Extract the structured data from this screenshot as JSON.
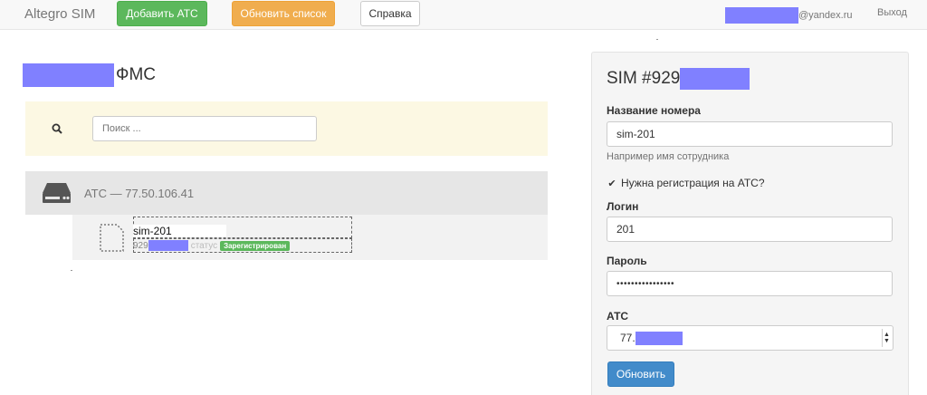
{
  "navbar": {
    "brand": "Altegro SIM",
    "add_pbx_label": "Добавить АТС",
    "refresh_list_label": "Обновить список",
    "help_label": "Справка",
    "user_email_suffix": "@yandex.ru",
    "logout_label": "Выход"
  },
  "main": {
    "title_suffix": "ФМС",
    "search": {
      "placeholder": "Поиск ..."
    },
    "pbx": {
      "title": "АТС — 77.50.106.41",
      "sim": {
        "name": "sim-201",
        "number_prefix": "929",
        "status_label": "статус",
        "status_badge": "Зарегистрирован"
      }
    }
  },
  "panel": {
    "title_prefix": "SIM #929",
    "name_label": "Название номера",
    "name_value": "sim-201",
    "name_help": "Например имя сотрудника",
    "registration_label": "Нужна регистрация на АТС?",
    "registration_checked": true,
    "login_label": "Логин",
    "login_value": "201",
    "password_label": "Пароль",
    "password_value": "••••••••••••••••",
    "pbx_label": "АТС",
    "pbx_selected_prefix": "77.",
    "update_label": "Обновить"
  },
  "colors": {
    "success": "#5cb85c",
    "warning": "#f0ad4e",
    "primary": "#428bca",
    "redaction": "#8080ff"
  }
}
